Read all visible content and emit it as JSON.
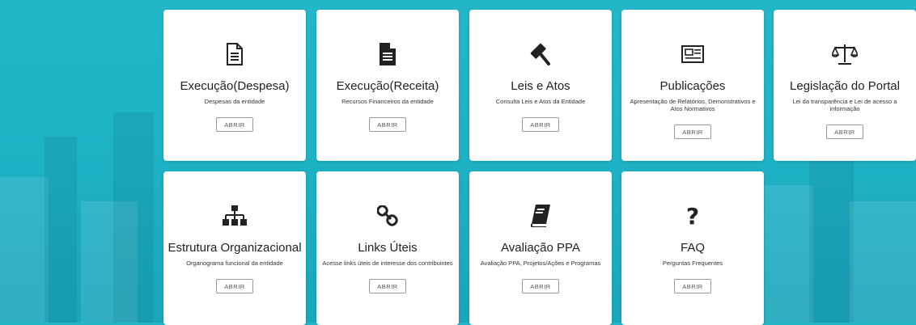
{
  "button_label": "ABRIR",
  "cards": [
    {
      "icon": "document-outline-icon",
      "title": "Execução(Despesa)",
      "desc": "Despesas da entidade"
    },
    {
      "icon": "document-filled-icon",
      "title": "Execução(Receita)",
      "desc": "Recursos Financeiros da entidade"
    },
    {
      "icon": "gavel-icon",
      "title": "Leis e Atos",
      "desc": "Consulta Leis e Atos da Entidade"
    },
    {
      "icon": "newspaper-icon",
      "title": "Publicações",
      "desc": "Apresentação de Relatórios, Demonstrativos e Atos Normativos"
    },
    {
      "icon": "balance-scale-icon",
      "title": "Legislação do Portal",
      "desc": "Lei da transparência e Lei de acesso a informação"
    },
    {
      "icon": "org-chart-icon",
      "title": "Estrutura Organizacional",
      "desc": "Organograma funcional da entidade"
    },
    {
      "icon": "link-icon",
      "title": "Links Úteis",
      "desc": "Acesse links úteis de interesse dos contribuintes"
    },
    {
      "icon": "book-icon",
      "title": "Avaliação PPA",
      "desc": "Avaliação PPA, Projetos/Ações e Programas"
    },
    {
      "icon": "question-icon",
      "title": "FAQ",
      "desc": "Perguntas Frequentes"
    }
  ]
}
